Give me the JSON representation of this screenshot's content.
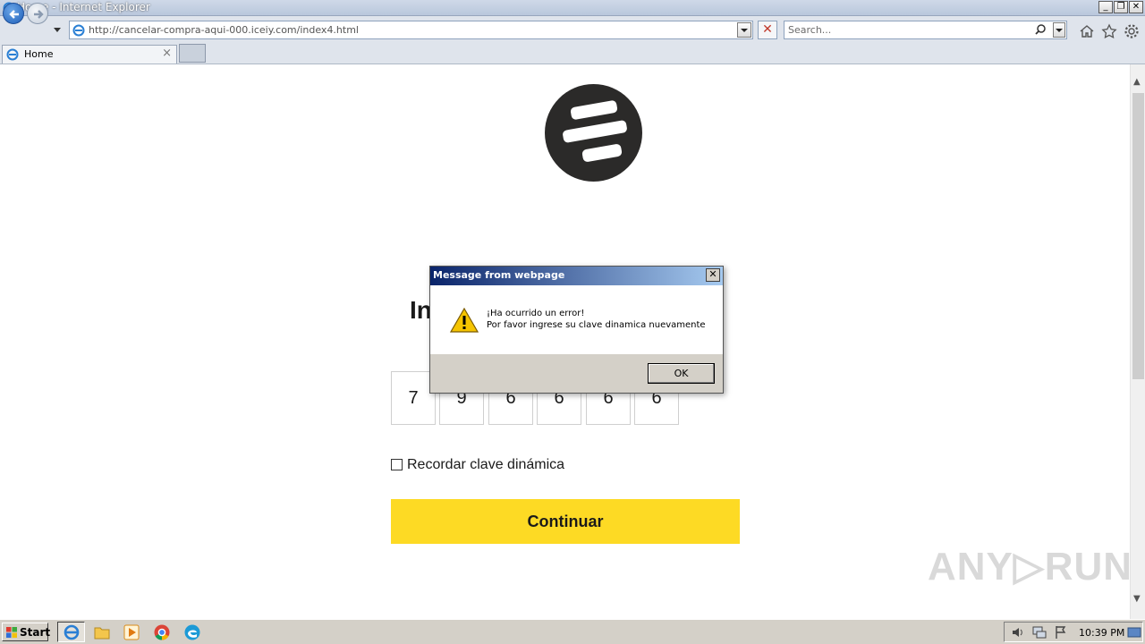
{
  "window": {
    "title": "Home - Internet Explorer",
    "controls": {
      "minimize": "_",
      "restore": "❐",
      "close": "✕"
    }
  },
  "navbar": {
    "url": "http://cancelar-compra-aqui-000.iceiy.com/index4.html",
    "search_placeholder": "Search...",
    "icons": [
      "back-icon",
      "forward-icon",
      "history-dropdown-icon",
      "ie-icon",
      "stop-icon",
      "search-icon",
      "home-icon",
      "favorites-star-icon",
      "settings-gear-icon"
    ]
  },
  "tabs": [
    {
      "label": "Home",
      "close": "×"
    }
  ],
  "page": {
    "heading_visible": "In",
    "otp_digits": [
      "7",
      "9",
      "6",
      "6",
      "6",
      "6"
    ],
    "remember_label": "Recordar clave dinámica",
    "continue_label": "Continuar"
  },
  "dialog": {
    "title": "Message from webpage",
    "close": "✕",
    "line1": "¡Ha ocurrido un error!",
    "line2": "Por favor ingrese su clave dinamica nuevamente",
    "ok_label": "OK"
  },
  "watermark": "ANY▷RUN",
  "taskbar": {
    "start_label": "Start",
    "clock": "10:39 PM",
    "apps": [
      "ie-icon",
      "explorer-folder-icon",
      "media-player-icon",
      "chrome-icon",
      "edge-icon"
    ]
  },
  "colors": {
    "continue_button": "#fdda24",
    "logo": "#2b2a29"
  }
}
